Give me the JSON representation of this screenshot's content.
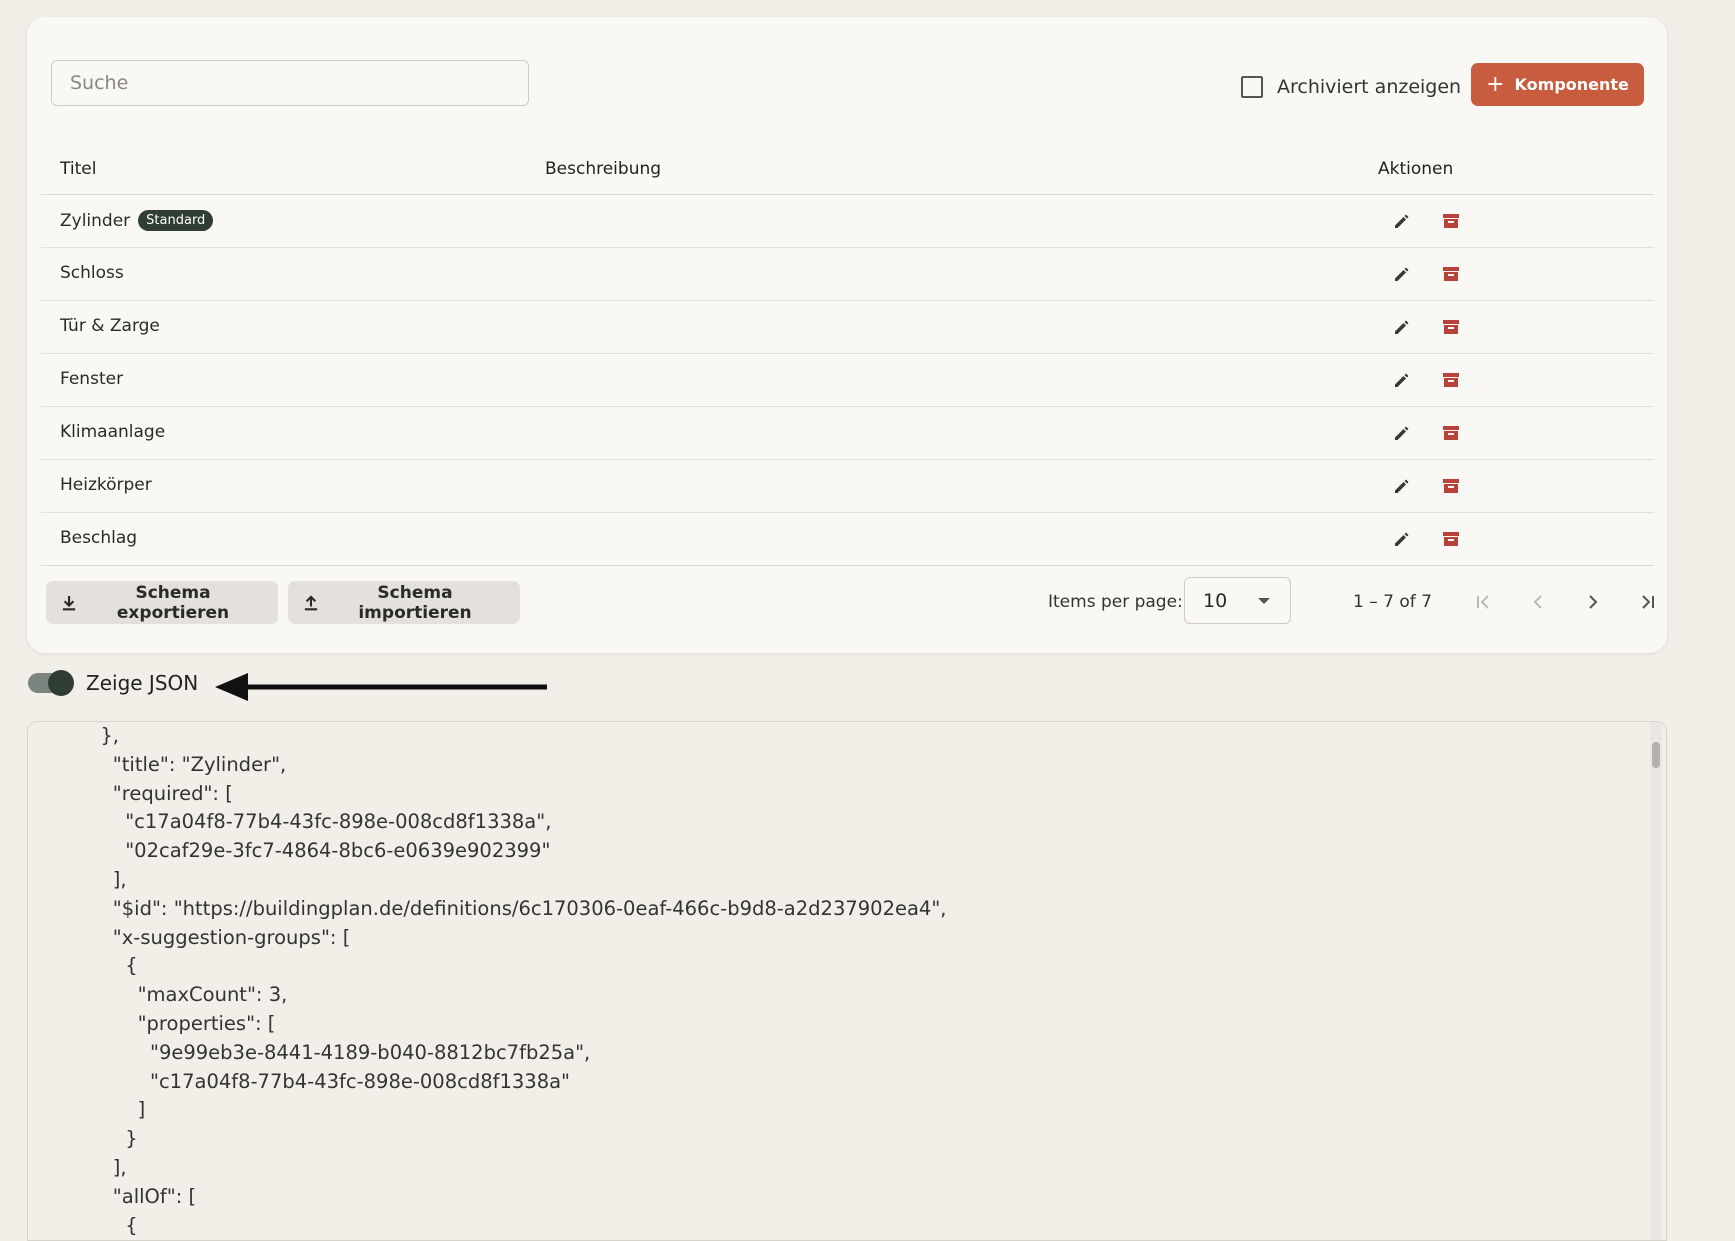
{
  "toolbar": {
    "search_placeholder": "Suche",
    "archived_label": "Archiviert anzeigen",
    "add_button_icon": "plus-icon",
    "add_button_label": "Komponente"
  },
  "table": {
    "columns": [
      "Titel",
      "Beschreibung",
      "Aktionen"
    ],
    "rows": [
      {
        "title": "Zylinder",
        "badge": "Standard",
        "description": ""
      },
      {
        "title": "Schloss",
        "description": ""
      },
      {
        "title": "Tür & Zarge",
        "description": ""
      },
      {
        "title": "Fenster",
        "description": ""
      },
      {
        "title": "Klimaanlage",
        "description": ""
      },
      {
        "title": "Heizkörper",
        "description": ""
      },
      {
        "title": "Beschlag",
        "description": ""
      }
    ]
  },
  "footer": {
    "export_label": "Schema exportieren",
    "import_label": "Schema importieren",
    "items_per_page_label": "Items per page:",
    "items_per_page_value": "10",
    "range": "1 – 7 of 7"
  },
  "json_toggle": {
    "label": "Zeige JSON",
    "enabled": true
  },
  "json_lines": [
    "},",
    "\"title\": \"Zylinder\",",
    "\"required\": [",
    "  \"c17a04f8-77b4-43fc-898e-008cd8f1338a\",",
    "  \"02caf29e-3fc7-4864-8bc6-e0639e902399\"",
    "],",
    "\"$id\": \"https://buildingplan.de/definitions/6c170306-0eaf-466c-b9d8-a2d237902ea4\",",
    "\"x-suggestion-groups\": [",
    "  {",
    "    \"maxCount\": 3,",
    "    \"properties\": [",
    "      \"9e99eb3e-8441-4189-b040-8812bc7fb25a\",",
    "      \"c17a04f8-77b4-43fc-898e-008cd8f1338a\"",
    "    ]",
    "  }",
    "],",
    "\"allOf\": [",
    "  {"
  ],
  "colors": {
    "accent": "#c85c3e",
    "badge": "#2f3d33",
    "archive_icon": "#b8413a",
    "background": "#f2efe9",
    "card": "#faf8f4"
  }
}
